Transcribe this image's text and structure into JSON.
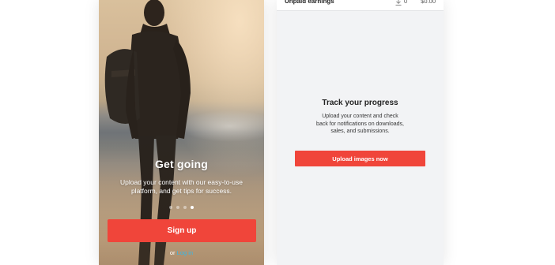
{
  "onboarding": {
    "title": "Get going",
    "body": "Upload your content with our easy-to-use platform, and get tips for success.",
    "pagination": {
      "count": 4,
      "active_index": 3
    },
    "signup_label": "Sign up",
    "login_prefix": "or",
    "login_label": "Log in",
    "colors": {
      "primary_button": "#f0453a",
      "link": "#35b8e8"
    }
  },
  "dashboard": {
    "earnings_bar": {
      "label": "Unpaid earnings",
      "downloads_icon": "download-icon",
      "downloads_count": "0",
      "amount": "$0.00"
    },
    "empty_state": {
      "title": "Track your progress",
      "body": "Upload your content and check back for notifications on downloads, sales, and submissions.",
      "cta_label": "Upload images now"
    },
    "colors": {
      "background": "#f2f3f5",
      "cta": "#f0453a"
    }
  }
}
